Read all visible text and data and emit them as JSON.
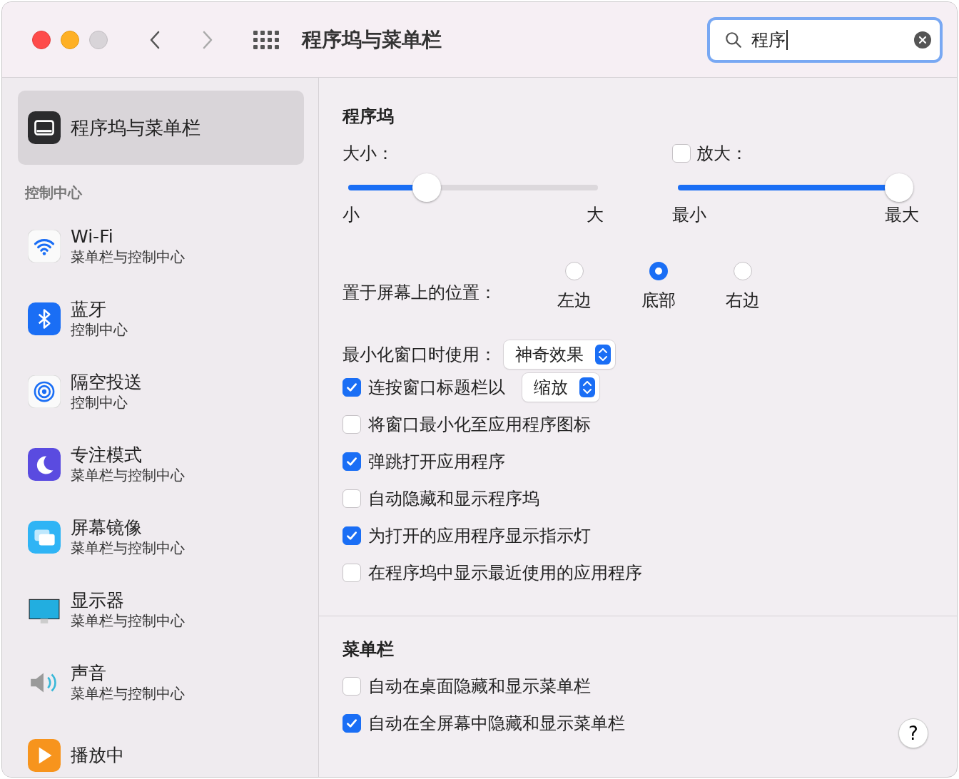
{
  "window": {
    "title": "程序坞与菜单栏"
  },
  "search": {
    "value": "程序"
  },
  "sidebar": {
    "selected_item": {
      "label": "程序坞与菜单栏",
      "selected": true
    },
    "section_title": "控制中心",
    "items": [
      {
        "label": "Wi-Fi",
        "subtitle": "菜单栏与控制中心",
        "selected": false
      },
      {
        "label": "蓝牙",
        "subtitle": "控制中心",
        "selected": false
      },
      {
        "label": "隔空投送",
        "subtitle": "控制中心",
        "selected": false
      },
      {
        "label": "专注模式",
        "subtitle": "菜单栏与控制中心",
        "selected": false
      },
      {
        "label": "屏幕镜像",
        "subtitle": "菜单栏与控制中心",
        "selected": false
      },
      {
        "label": "显示器",
        "subtitle": "菜单栏与控制中心",
        "selected": false
      },
      {
        "label": "声音",
        "subtitle": "菜单栏与控制中心",
        "selected": false
      },
      {
        "label": "播放中",
        "selected": false
      }
    ]
  },
  "dock": {
    "title": "程序坞",
    "size": {
      "label": "大小：",
      "level": 0.29,
      "min_label": "小",
      "max_label": "大"
    },
    "magnification": {
      "label": "放大：",
      "checked": false,
      "level": 1,
      "min_label": "最小",
      "max_label": "最大"
    },
    "position": {
      "label": "置于屏幕上的位置：",
      "options": [
        {
          "label": "左边",
          "selected": false
        },
        {
          "label": "底部",
          "selected": true
        },
        {
          "label": "右边",
          "selected": false
        }
      ]
    },
    "minimize_effect": {
      "label": "最小化窗口时使用：",
      "value": "神奇效果"
    },
    "options": [
      {
        "kind": "select",
        "label": "连按窗口标题栏以",
        "checked": true,
        "value": "缩放"
      },
      {
        "kind": "checkbox",
        "label": "将窗口最小化至应用程序图标",
        "checked": false
      },
      {
        "kind": "checkbox",
        "label": "弹跳打开应用程序",
        "checked": true
      },
      {
        "kind": "checkbox",
        "label": "自动隐藏和显示程序坞",
        "checked": false
      },
      {
        "kind": "checkbox",
        "label": "为打开的应用程序显示指示灯",
        "checked": true
      },
      {
        "kind": "checkbox",
        "label": "在程序坞中显示最近使用的应用程序",
        "checked": false
      }
    ]
  },
  "menu_bar": {
    "title": "菜单栏",
    "options": [
      {
        "kind": "checkbox",
        "label": "自动在桌面隐藏和显示菜单栏",
        "checked": false
      },
      {
        "kind": "checkbox",
        "label": "自动在全屏幕中隐藏和显示菜单栏",
        "checked": true
      }
    ]
  },
  "help_button": {
    "label": "?"
  }
}
